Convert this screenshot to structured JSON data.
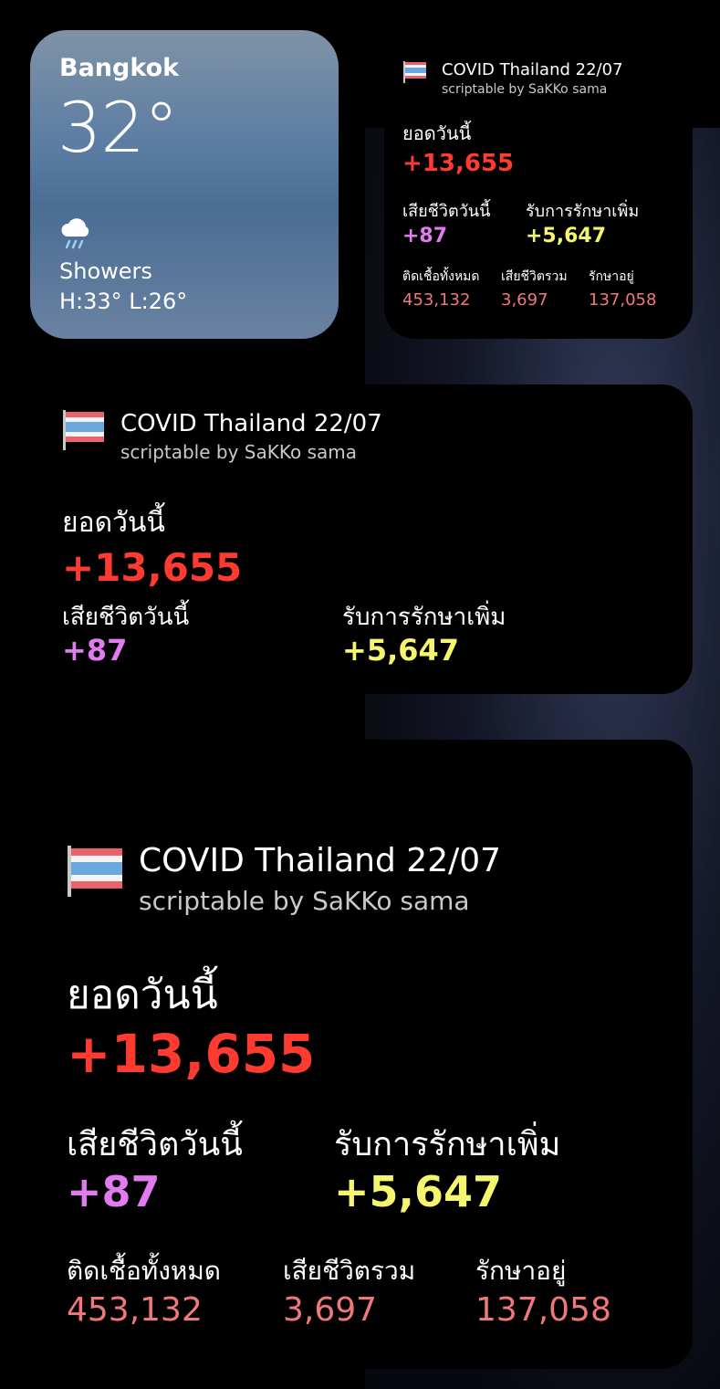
{
  "colors": {
    "red": "#ff3b30",
    "pink": "#e27af0",
    "yellow": "#f6f56e",
    "salmon": "#f0787a",
    "white": "#ffffff",
    "gray": "#c9c9c9"
  },
  "weather": {
    "city": "Bangkok",
    "temperature": "32°",
    "icon": "cloud-rain-icon",
    "condition": "Showers",
    "high_low": "H:33° L:26°"
  },
  "covid": {
    "flag_icon": "thailand-flag-icon",
    "title": "COVID Thailand 22/07",
    "subtitle": "scriptable by SaKKo sama",
    "today_label": "ยอดวันนี้",
    "today_value": "+13,655",
    "deaths_today_label": "เสียชีวิตวันนี้",
    "deaths_today_value": "+87",
    "recovered_today_label": "รับการรักษาเพิ่ม",
    "recovered_today_value": "+5,647",
    "total_infected_label": "ติดเชื้อทั้งหมด",
    "total_infected_value": "453,132",
    "total_deaths_label": "เสียชีวิตรวม",
    "total_deaths_value": "3,697",
    "in_treatment_label": "รักษาอยู่",
    "in_treatment_value": "137,058"
  }
}
